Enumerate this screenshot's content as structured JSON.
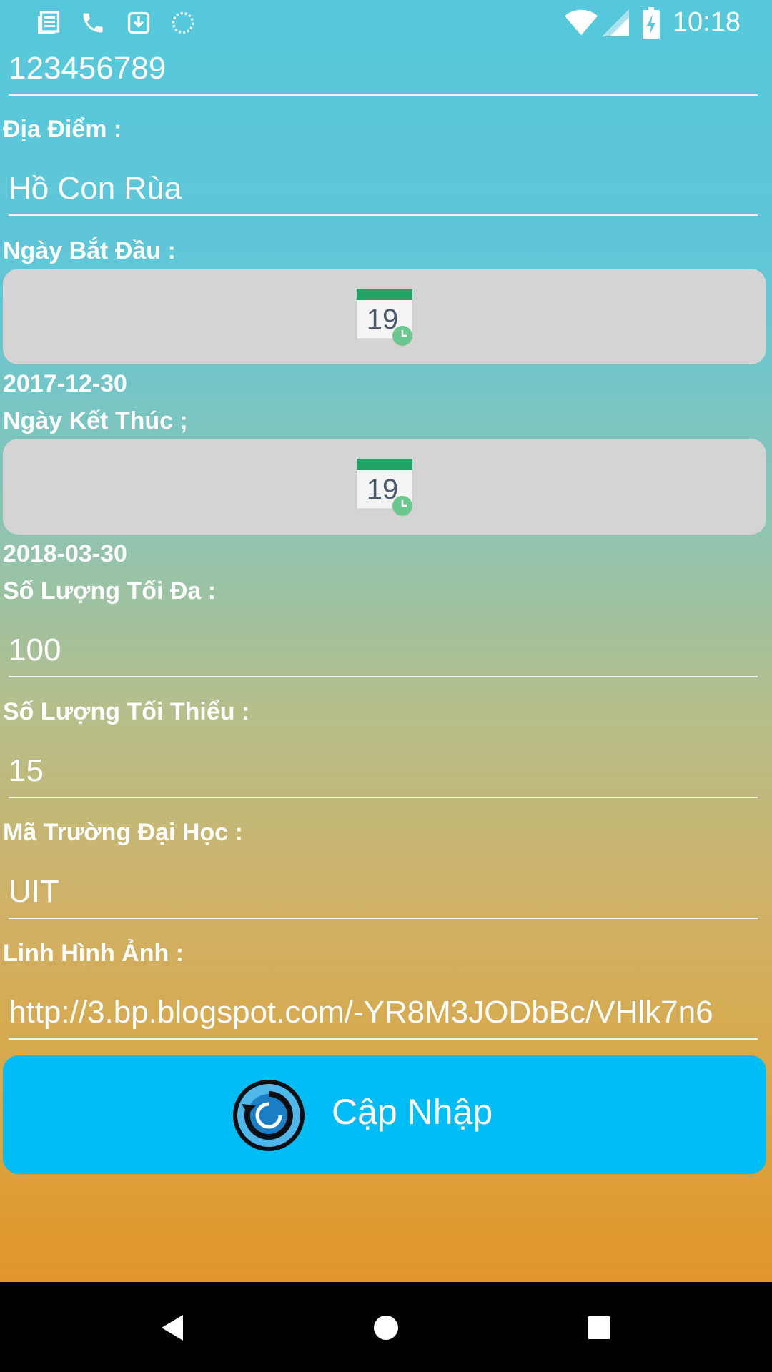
{
  "status_bar": {
    "time": "10:18",
    "left_icons": [
      "news-icon",
      "phone-icon",
      "download-icon",
      "sync-icon"
    ],
    "right_icons": [
      "wifi-icon",
      "signal-icon",
      "battery-charging-icon"
    ]
  },
  "form": {
    "phone_value": "123456789",
    "location": {
      "label": "Địa Điểm :",
      "value": "Hồ Con Rùa"
    },
    "start_date": {
      "label": "Ngày Bắt Đầu :",
      "calendar_number": "19",
      "value": "2017-12-30"
    },
    "end_date": {
      "label": "Ngày Kết Thúc ;",
      "calendar_number": "19",
      "value": "2018-03-30"
    },
    "max_quantity": {
      "label": "Số Lượng Tối Đa :",
      "value": "100"
    },
    "min_quantity": {
      "label": "Số Lượng Tối Thiểu :",
      "value": "15"
    },
    "university_code": {
      "label": "Mã Trường Đại Học :",
      "value": "UIT"
    },
    "image_link": {
      "label": "Linh Hình Ảnh :",
      "value": "http://3.bp.blogspot.com/-YR8M3JODbBc/VHlk7n6"
    }
  },
  "update_button": {
    "label": "Cập Nhập",
    "icon": "refresh-icon"
  },
  "nav_bar": {
    "buttons": [
      "back-icon",
      "home-icon",
      "recents-icon"
    ]
  },
  "colors": {
    "accent_button": "#00bcf4",
    "date_button": "#d4d4d4",
    "calendar_green": "#21a366"
  }
}
